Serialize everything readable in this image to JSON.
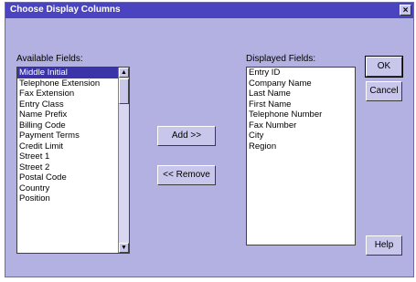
{
  "window": {
    "title": "Choose Display Columns",
    "close_glyph": "×"
  },
  "available": {
    "label": "Available Fields:",
    "items": [
      "Middle Initial",
      "Telephone Extension",
      "Fax Extension",
      "Entry Class",
      "Name Prefix",
      "Billing Code",
      "Payment Terms",
      "Credit Limit",
      "Street 1",
      "Street 2",
      "Postal Code",
      "Country",
      "Position"
    ],
    "selected_index": 0
  },
  "displayed": {
    "label": "Displayed Fields:",
    "items": [
      "Entry ID",
      "Company Name",
      "Last Name",
      "First Name",
      "Telephone Number",
      "Fax Number",
      "City",
      "Region"
    ]
  },
  "buttons": {
    "add": "Add >>",
    "remove": "<< Remove",
    "ok": "OK",
    "cancel": "Cancel",
    "help": "Help"
  },
  "scroll": {
    "up_glyph": "▲",
    "down_glyph": "▼"
  }
}
